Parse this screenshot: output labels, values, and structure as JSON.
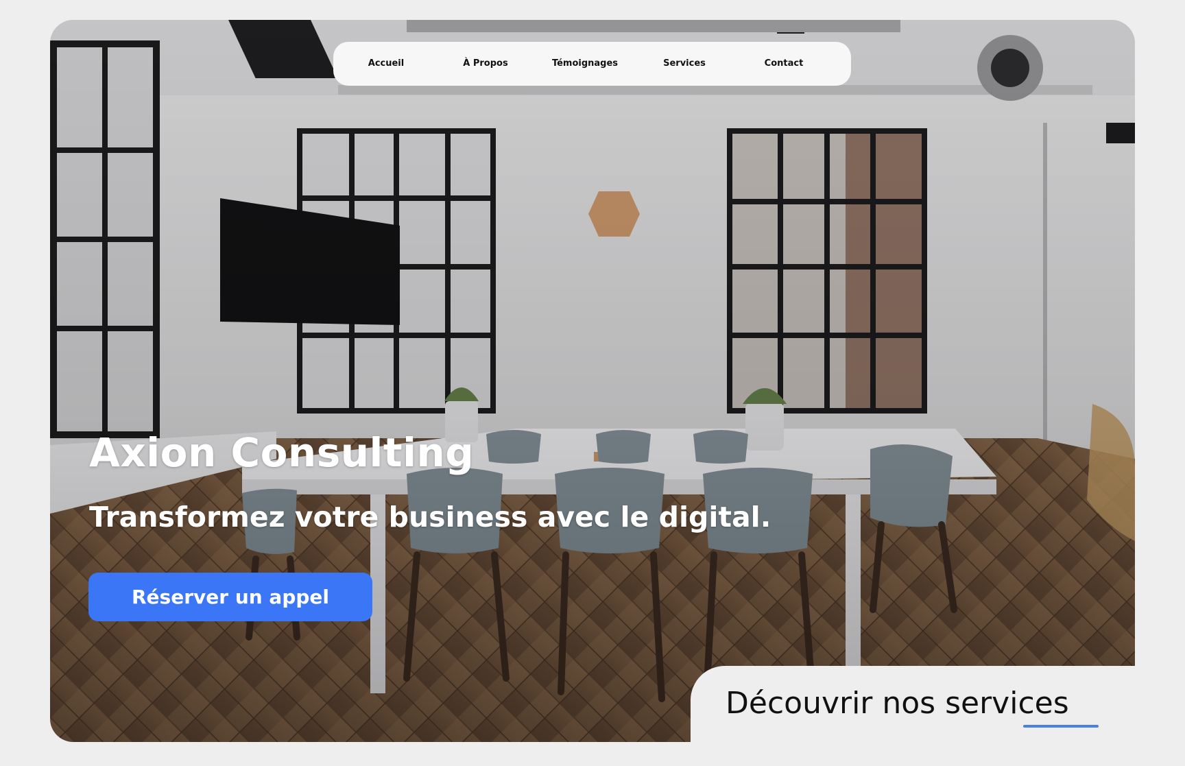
{
  "nav": {
    "items": [
      {
        "label": "Accueil"
      },
      {
        "label": "À Propos"
      },
      {
        "label": "Témoignages"
      },
      {
        "label": "Services"
      },
      {
        "label": "Contact"
      }
    ]
  },
  "hero": {
    "title": "Axion Consulting",
    "subtitle": "Transformez votre business avec le digital.",
    "cta_label": "Réserver un appel",
    "discover_label": "Découvrir nos services"
  },
  "colors": {
    "accent": "#3b76f6",
    "underline": "#4a7fe6",
    "page_background": "#eeeeee",
    "nav_background": "#f7f7f7"
  }
}
